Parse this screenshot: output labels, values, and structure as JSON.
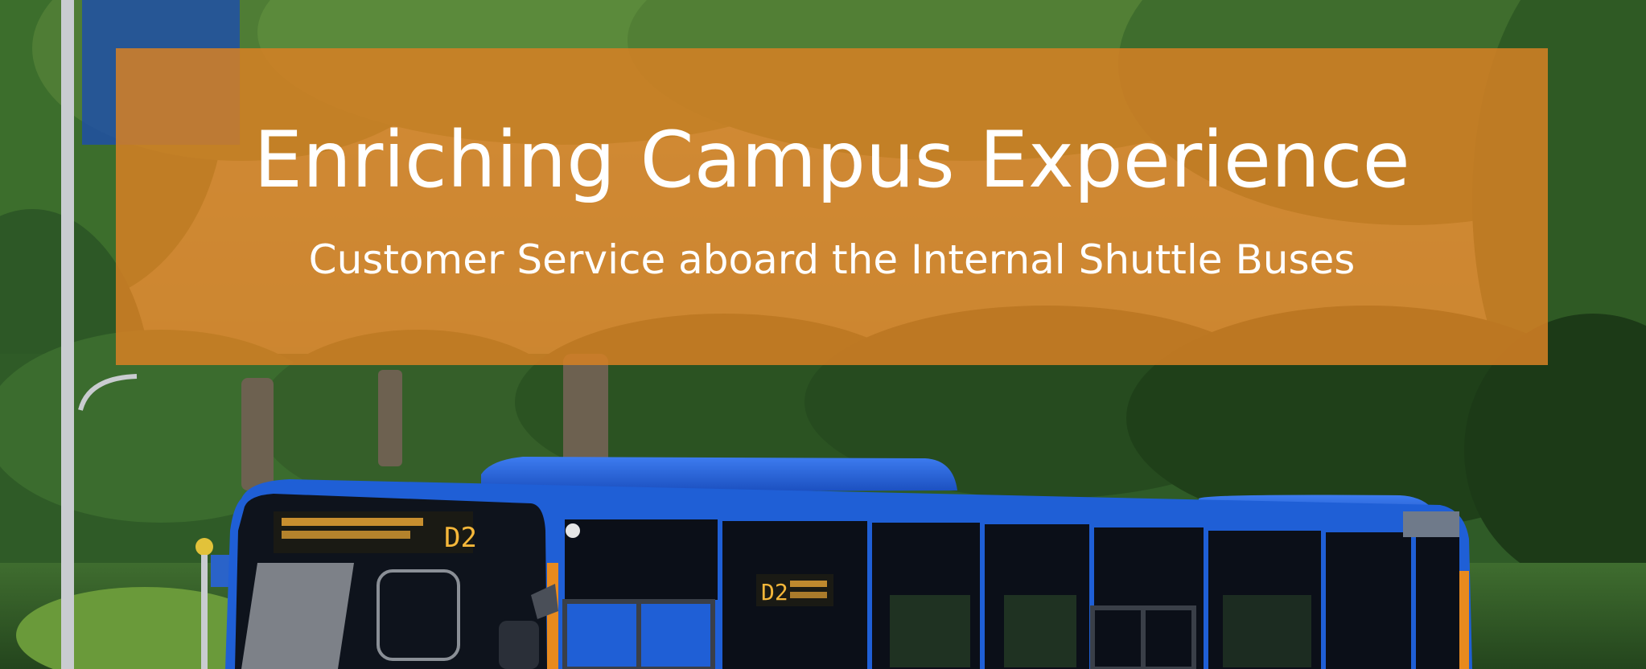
{
  "banner": {
    "title": "Enriching Campus Experience",
    "subtitle": "Customer Service aboard the Internal Shuttle Buses",
    "color": "#d68024"
  },
  "bus": {
    "route_front": "D2",
    "route_side": "D2",
    "body_color": "#1f5fd6",
    "window_color": "#0b0f18",
    "stripe_color": "#e88a1e"
  },
  "scene": {
    "foliage_color": "#2f5e2a",
    "sky_color": "#c9d7b8"
  }
}
